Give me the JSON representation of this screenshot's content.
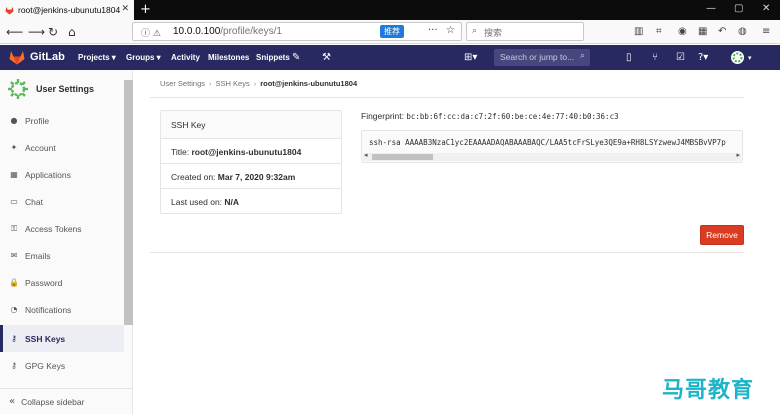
{
  "browser": {
    "tab_title": "root@jenkins-ubunutu1804",
    "url_host": "10.0.0.100",
    "url_path": "/profile/keys/1",
    "recommend_label": "推荐",
    "search_placeholder": "搜索",
    "new_tab": "+",
    "win_min": "—",
    "win_max": "▢",
    "win_close": "✕"
  },
  "gitlab_header": {
    "brand": "GitLab",
    "nav": [
      "Projects ▾",
      "Groups ▾",
      "Activity",
      "Milestones",
      "Snippets"
    ],
    "search_placeholder": "Search or jump to..."
  },
  "sidebar": {
    "title": "User Settings",
    "items": [
      {
        "label": "Profile",
        "icon": "●"
      },
      {
        "label": "Account",
        "icon": "✦"
      },
      {
        "label": "Applications",
        "icon": "▦"
      },
      {
        "label": "Chat",
        "icon": "▭"
      },
      {
        "label": "Access Tokens",
        "icon": "⚿"
      },
      {
        "label": "Emails",
        "icon": "✉"
      },
      {
        "label": "Password",
        "icon": "🔒"
      },
      {
        "label": "Notifications",
        "icon": "◔"
      },
      {
        "label": "SSH Keys",
        "icon": "⚷"
      },
      {
        "label": "GPG Keys",
        "icon": "⚷"
      }
    ],
    "collapse_label": "Collapse sidebar",
    "collapse_icon": "«"
  },
  "breadcrumb": {
    "items": [
      "User Settings",
      "SSH Keys",
      "root@jenkins-ubunutu1804"
    ]
  },
  "ssh_key": {
    "header": "SSH Key",
    "title_label": "Title:",
    "title_value": "root@jenkins-ubunutu1804",
    "created_label": "Created on:",
    "created_value": "Mar 7, 2020 9:32am",
    "last_used_label": "Last used on:",
    "last_used_value": "N/A",
    "fingerprint_label": "Fingerprint:",
    "fingerprint_value": "bc:bb:6f:cc:da:c7:2f:60:be:ce:4e:77:40:b0:36:c3",
    "key_text": "ssh-rsa AAAAB3NzaC1yc2EAAAADAQABAAABAQC/LAA5tcFrSLye3QE9a+RH8LSYzwewJ4MBSBvVP7p",
    "remove_label": "Remove"
  },
  "watermark": "马哥教育",
  "colors": {
    "header_bg": "#292961",
    "remove_bg": "#db3b21",
    "watermark": "#1cb4c9"
  }
}
